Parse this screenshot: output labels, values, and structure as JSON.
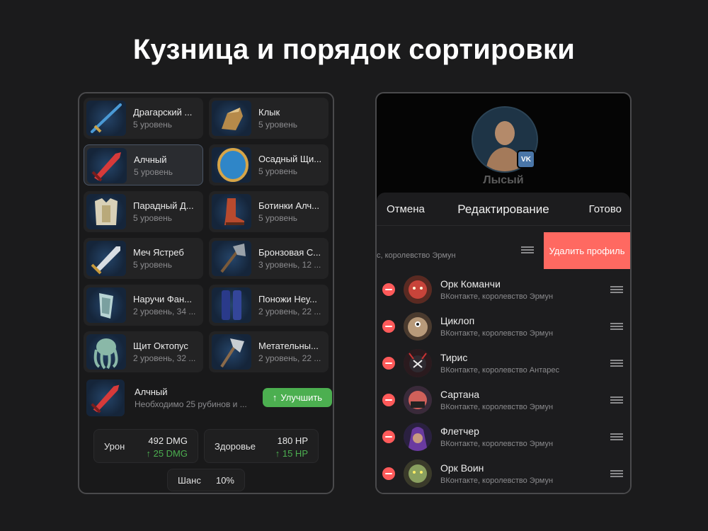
{
  "title": "Кузница и порядок сортировки",
  "forge": {
    "items": [
      {
        "name": "Драгарский ...",
        "level": "5 уровень",
        "icon": "spear-icon"
      },
      {
        "name": "Клык",
        "level": "5 уровень",
        "icon": "gauntlet-icon"
      },
      {
        "name": "Алчный",
        "level": "5 уровень",
        "icon": "red-sword-icon"
      },
      {
        "name": "Осадный Щи...",
        "level": "5 уровень",
        "icon": "shield-icon"
      },
      {
        "name": "Парадный Д...",
        "level": "5 уровень",
        "icon": "armor-icon"
      },
      {
        "name": "Ботинки Алч...",
        "level": "5 уровень",
        "icon": "boots-icon"
      },
      {
        "name": "Меч Ястреб",
        "level": "5 уровень",
        "icon": "sword-icon"
      },
      {
        "name": "Бронзовая С...",
        "level": "3 уровень, 12 ...",
        "icon": "axe-icon"
      },
      {
        "name": "Наручи Фан...",
        "level": "2 уровень, 34 ...",
        "icon": "bracers-icon"
      },
      {
        "name": "Поножи Неу...",
        "level": "2 уровень, 22 ...",
        "icon": "greaves-icon"
      },
      {
        "name": "Щит Октопус",
        "level": "2 уровень, 32 ...",
        "icon": "octopus-shield-icon"
      },
      {
        "name": "Метательны...",
        "level": "2 уровень, 22 ...",
        "icon": "throwing-axe-icon"
      }
    ],
    "selected": {
      "name": "Алчный",
      "description": "Необходимо 25 рубинов и ...",
      "upgrade_label": "Улучшить"
    },
    "stats": {
      "damage": {
        "label": "Урон",
        "value": "492 DMG",
        "delta": "25 DMG"
      },
      "health": {
        "label": "Здоровье",
        "value": "180 HP",
        "delta": "15 HP"
      },
      "chance": {
        "label": "Шанс",
        "value": "10%"
      }
    }
  },
  "profiles": {
    "profile_name": "Лысый",
    "vk_badge": "VK",
    "header": {
      "cancel": "Отмена",
      "title": "Редактирование",
      "done": "Готово"
    },
    "swiped_row": {
      "subtitle": "с, королевство Эрмун",
      "delete_label": "Удалить профиль"
    },
    "rows": [
      {
        "name": "Орк Команчи",
        "subtitle": "ВКонтакте, королевство Эрмун"
      },
      {
        "name": "Циклоп",
        "subtitle": "ВКонтакте, королевство Эрмун"
      },
      {
        "name": "Тирис",
        "subtitle": "ВКонтакте, королевство Антарес"
      },
      {
        "name": "Сартана",
        "subtitle": "ВКонтакте, королевство Эрмун"
      },
      {
        "name": "Флетчер",
        "subtitle": "ВКонтакте, королевство Эрмун"
      },
      {
        "name": "Орк Воин",
        "subtitle": "ВКонтакте, королевство Эрмун"
      }
    ]
  },
  "colors": {
    "background": "#1b1b1c",
    "accent_green": "#4caf50",
    "delete_red": "#ff6961",
    "minus_red": "#ff5a5a"
  }
}
